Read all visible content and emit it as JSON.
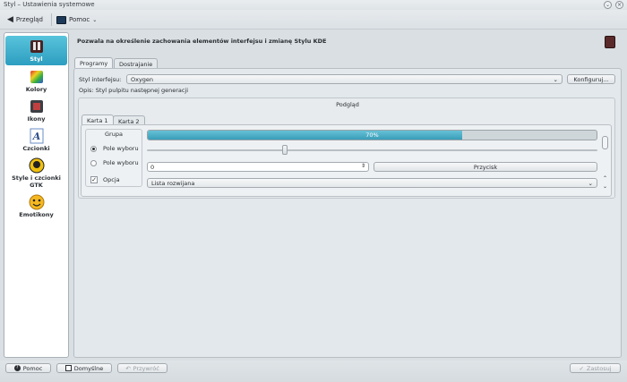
{
  "window": {
    "title": "Styl – Ustawienia systemowe"
  },
  "toolbar": {
    "overview": "Przegląd",
    "help": "Pomoc"
  },
  "sidebar": {
    "items": [
      {
        "label": "Styl",
        "selected": true,
        "icon": "style-icon"
      },
      {
        "label": "Kolory",
        "icon": "colors-icon"
      },
      {
        "label": "Ikony",
        "icon": "icons-icon"
      },
      {
        "label": "Czcionki",
        "icon": "fonts-icon"
      },
      {
        "label": "Style i czcionki GTK",
        "icon": "gtk-icon"
      },
      {
        "label": "Emotikony",
        "icon": "emoticons-icon"
      }
    ]
  },
  "main": {
    "description": "Pozwala na określenie zachowania elementów interfejsu i zmianę Stylu KDE",
    "tabs": [
      {
        "label": "Programy",
        "selected": true
      },
      {
        "label": "Dostrajanie"
      }
    ],
    "style_label": "Styl interfejsu:",
    "style_value": "Oxygen",
    "configure_label": "Konfiguruj...",
    "style_description": "Opis: Styl pulpitu następnej generacji",
    "preview": {
      "title": "Podgląd",
      "tabs": [
        {
          "label": "Karta 1",
          "selected": true
        },
        {
          "label": "Karta 2"
        }
      ],
      "group_label": "Grupa",
      "radio1": "Pole wyboru",
      "radio2": "Pole wyboru",
      "checkbox_label": "Opcja",
      "progress_text": "70%",
      "progress_value": 0.7,
      "spin_value": "0",
      "push_button": "Przycisk",
      "combo_value": "Lista rozwijana"
    }
  },
  "bottom": {
    "help": "Pomoc",
    "defaults": "Domyślne",
    "reset": "Przywróć",
    "apply": "Zastosuj"
  },
  "colors": {
    "accent": "#3a9db8",
    "selection": "#2d9ec0"
  }
}
